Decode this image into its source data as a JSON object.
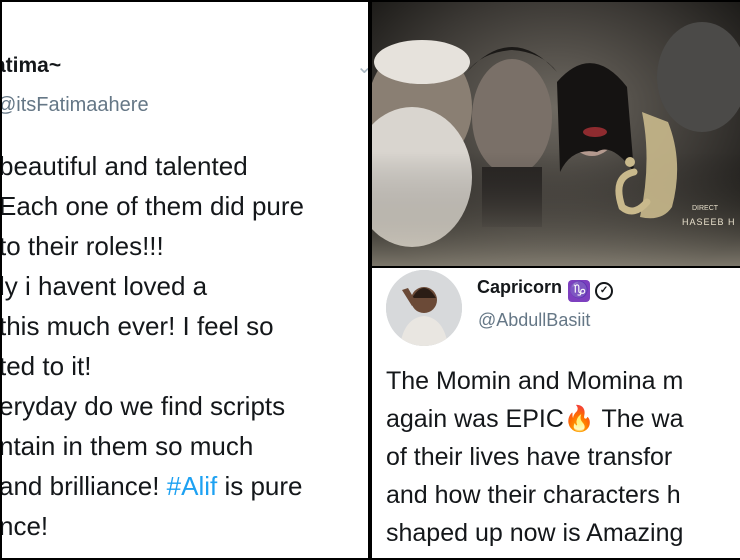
{
  "left_tweet": {
    "display_name": "atima~",
    "handle": "@itsFatimaahere",
    "menu_icon": "chevron-down-icon",
    "lines": [
      "beautiful and talented",
      "Each one of them did pure",
      "to their roles!!!",
      "ly i havent loved a",
      "this much ever! I feel so",
      "ted to it!",
      "eryday do we find scripts",
      "ntain in them so much",
      "and brilliance! ",
      "nce!"
    ],
    "hashtag": "#Alif",
    "hashtag_suffix": " is pure"
  },
  "poster": {
    "title_glyph": "الف",
    "letter": "Λ",
    "director_label": "DIRECT",
    "director_name": "HASEEB H"
  },
  "right_tweet": {
    "display_name": "Capricorn",
    "zodiac_glyph": "♑",
    "badge_glyph": "✓",
    "handle": "@AbdullBasiit",
    "lines": [
      "The Momin and Momina m",
      "again was EPIC",
      "of their lives have transfor",
      "and how their characters h",
      "shaped up now is Amazing"
    ],
    "fire_emoji": "🔥",
    "line2_suffix": " The wa"
  },
  "colors": {
    "hashtag": "#1da1f2",
    "handle_grey": "#657786",
    "zodiac_purple": "#7d3fbf"
  }
}
